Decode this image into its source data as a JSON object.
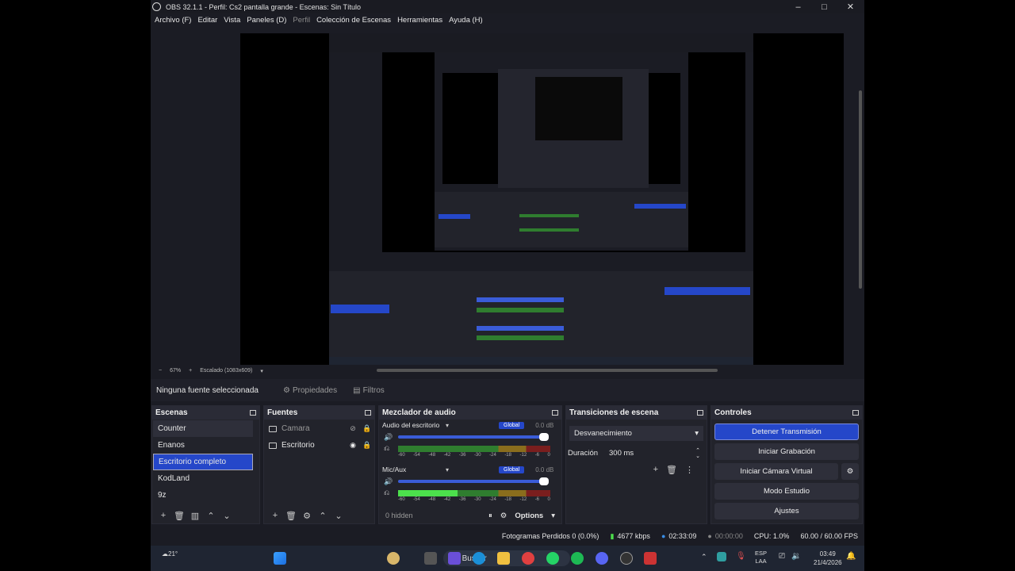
{
  "window": {
    "title": "OBS 32.1.1 - Perfil: Cs2 pantalla grande - Escenas: Sin Título",
    "minimize": "–",
    "maximize": "□",
    "close": "✕"
  },
  "menu": [
    {
      "label": "Archivo (F)",
      "enabled": true
    },
    {
      "label": "Editar",
      "enabled": true
    },
    {
      "label": "Vista",
      "enabled": true
    },
    {
      "label": "Paneles (D)",
      "enabled": true
    },
    {
      "label": "Perfil",
      "enabled": false
    },
    {
      "label": "Colección de Escenas",
      "enabled": true
    },
    {
      "label": "Herramientas",
      "enabled": true
    },
    {
      "label": "Ayuda (H)",
      "enabled": true
    }
  ],
  "preview_bar": {
    "zoom": "67%",
    "scaling": "Escalado (1083x609)"
  },
  "source_bar": {
    "none_selected": "Ninguna fuente seleccionada",
    "properties": "Propiedades",
    "filters": "Filtros"
  },
  "docks": {
    "scenes": {
      "title": "Escenas",
      "items": [
        "Counter",
        "Enanos",
        "Escritorio completo",
        "KodLand",
        "9z"
      ],
      "selected_index": 2
    },
    "sources": {
      "title": "Fuentes",
      "items": [
        {
          "name": "Camara",
          "visible": false
        },
        {
          "name": "Escritorio",
          "visible": true
        }
      ]
    },
    "mixer": {
      "title": "Mezclador de audio",
      "channels": [
        {
          "name": "Audio del escritorio",
          "global": "Global",
          "db": "0.0 dB",
          "volume": 1.0,
          "level": 0.0
        },
        {
          "name": "Mic/Aux",
          "global": "Global",
          "db": "0.0 dB",
          "volume": 1.0,
          "level": 0.39
        }
      ],
      "ticks": [
        "-60",
        "-54",
        "-48",
        "-42",
        "-36",
        "-30",
        "-24",
        "-18",
        "-12",
        "-6",
        "0"
      ],
      "hidden": "0 hidden",
      "options": "Options"
    },
    "transitions": {
      "title": "Transiciones de escena",
      "transition": "Desvanecimiento",
      "duration_label": "Duración",
      "duration_value": "300 ms"
    },
    "controls": {
      "title": "Controles",
      "stop_stream": "Detener Transmisión",
      "start_record": "Iniciar Grabación",
      "virtual_cam": "Iniciar Cámara Virtual",
      "studio": "Modo Estudio",
      "settings": "Ajustes"
    }
  },
  "status": {
    "dropped": "Fotogramas Perdidos 0 (0.0%)",
    "bitrate": "4677 kbps",
    "stream_time": "02:33:09",
    "record_time": "00:00:00",
    "cpu": "CPU: 1.0%",
    "fps": "60.00 / 60.00 FPS"
  },
  "taskbar": {
    "weather": "21°",
    "search": "Buscar",
    "lang_top": "ESP",
    "lang_bottom": "LAA",
    "time": "03:49",
    "date": "21/4/2026"
  },
  "colors": {
    "accent": "#2547c9",
    "bg": "#1b1c24",
    "dock": "#22232b",
    "header": "#2a2b36"
  }
}
